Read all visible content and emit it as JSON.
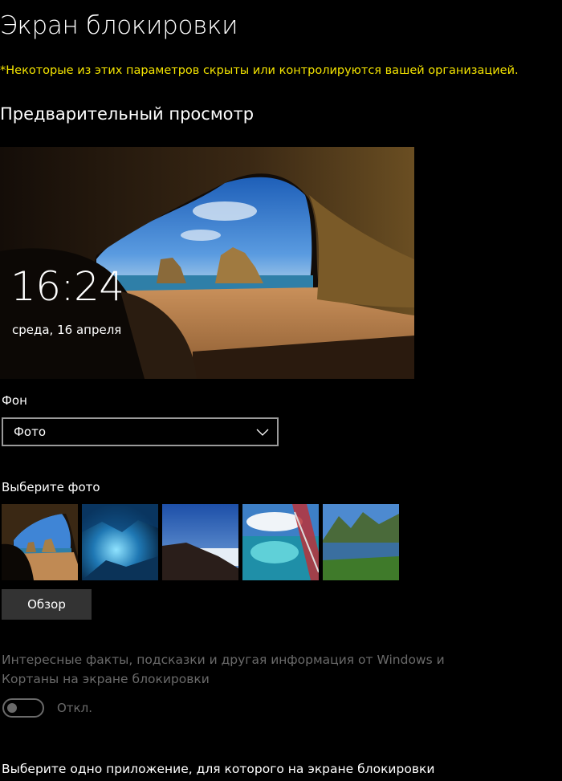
{
  "page": {
    "title": "Экран блокировки",
    "notice": "*Некоторые из этих параметров скрыты или контролируются вашей организацией."
  },
  "preview": {
    "heading": "Предварительный просмотр",
    "time": "16:24",
    "date": "среда, 16 апреля"
  },
  "background": {
    "label": "Фон",
    "selected": "Фото",
    "dropdown_icon": "chevron-down-icon"
  },
  "photos": {
    "label": "Выберите фото",
    "thumbnails": [
      "cave-beach",
      "ice-cave",
      "mountain-clouds",
      "lagoon-airplane",
      "fjord-lake"
    ],
    "browse_label": "Обзор"
  },
  "fun_facts": {
    "description": "Интересные факты, подсказки и другая информация от Windows и Кортаны на экране блокировки",
    "toggle_state": "Откл.",
    "enabled": false
  },
  "app_status": {
    "label": "Выберите одно приложение, для которого на экране блокировки"
  },
  "colors": {
    "background": "#000000",
    "notice": "#f4e400",
    "disabled_text": "#6a6a6a",
    "button": "#333333"
  }
}
